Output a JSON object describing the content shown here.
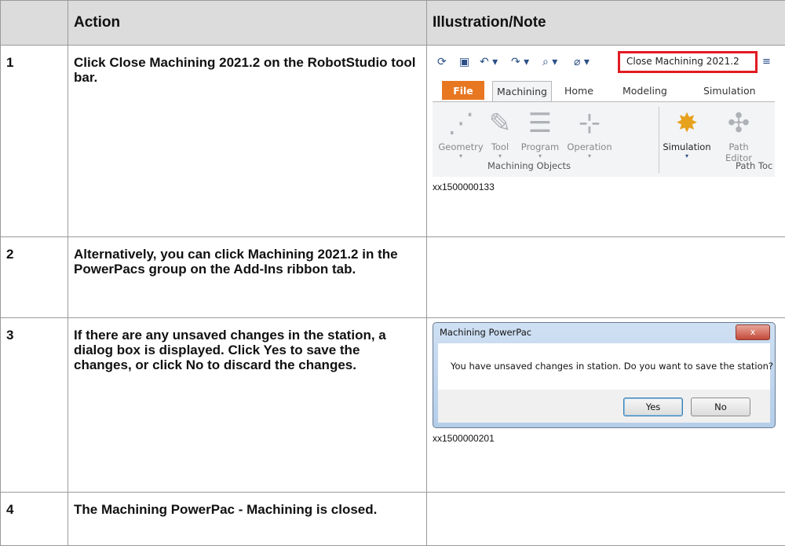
{
  "table": {
    "headers": [
      "",
      "Action",
      "Illustration/Note"
    ],
    "rows": [
      {
        "num": "1",
        "action_parts": [
          "Click ",
          "Close Machining 2021.2",
          " on the RobotStudio tool bar."
        ],
        "figure_id": "xx1500000133"
      },
      {
        "num": "2",
        "action_parts": [
          "Alternatively, you can click ",
          "Machining 2021.2",
          " in the ",
          "PowerPacs",
          " group on the ",
          "Add-Ins",
          " ribbon tab."
        ]
      },
      {
        "num": "3",
        "action_parts": [
          "If there are any unsaved changes in the station, a dialog box is displayed. Click ",
          "Yes",
          " to save the changes, or click ",
          "No",
          " to discard the changes."
        ],
        "figure_id": "xx1500000201"
      },
      {
        "num": "4",
        "action": "The Machining PowerPac - Machining is closed."
      }
    ]
  },
  "ribbon": {
    "close_title": "Close Machining 2021.2",
    "tabs": [
      "File",
      "Machining",
      "Home",
      "Modeling",
      "Simulation"
    ],
    "buttons": [
      "Geometry",
      "Tool",
      "Program",
      "Operation",
      "Simulation",
      "Path Editor"
    ],
    "groups": [
      "Machining Objects",
      "Path Toc"
    ]
  },
  "dialog": {
    "title": "Machining PowerPac",
    "close": "x",
    "message": "You have unsaved changes in station. Do you want to save the station?",
    "yes": "Yes",
    "no": "No"
  }
}
